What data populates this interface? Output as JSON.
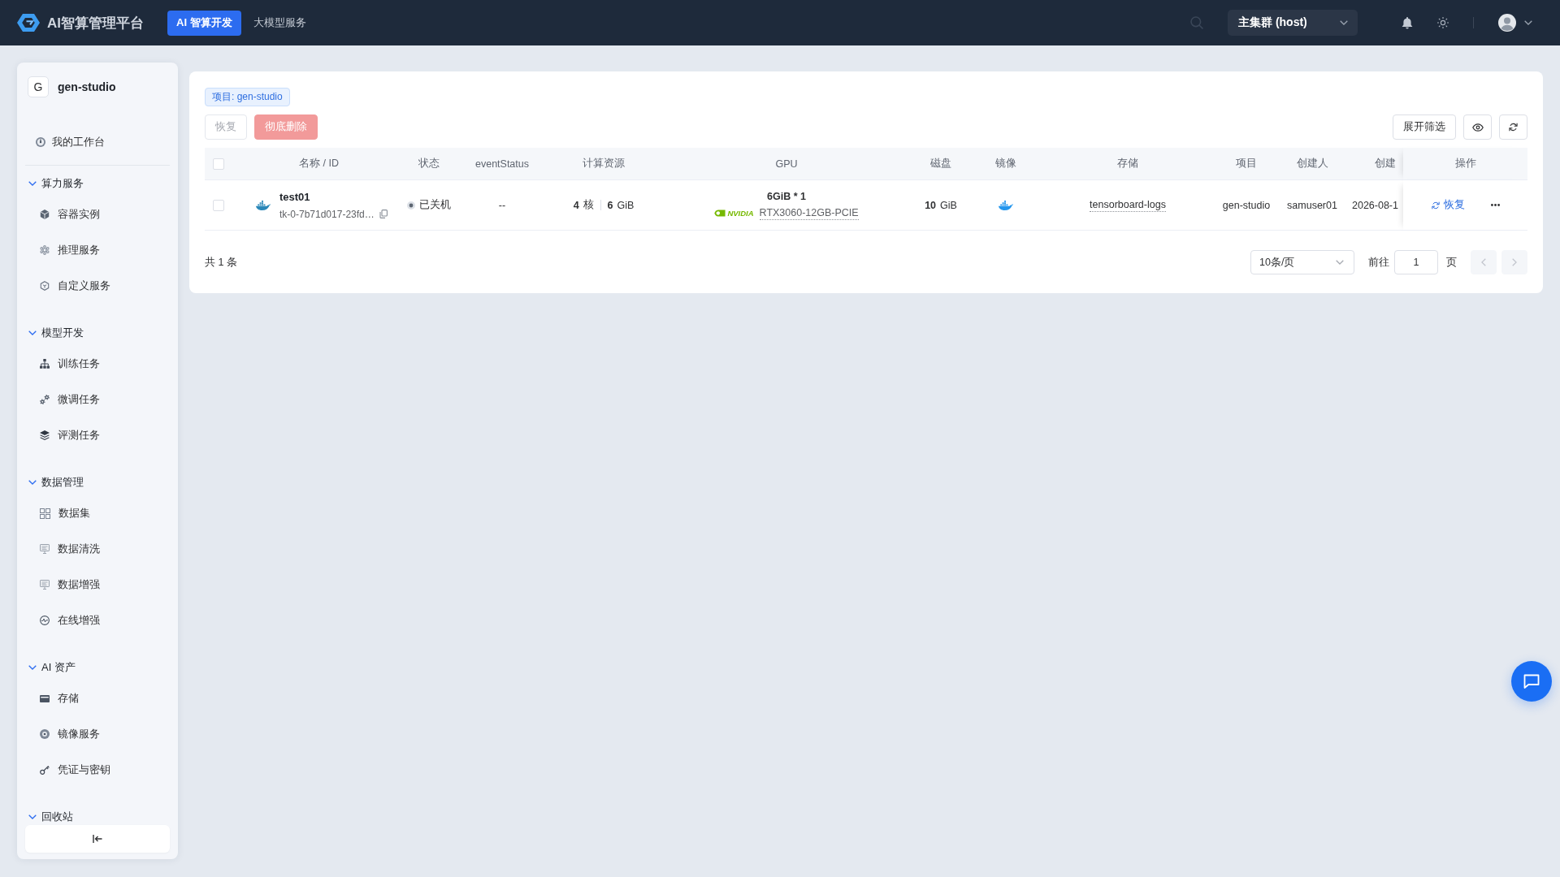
{
  "header": {
    "logo_text": "AI智算管理平台",
    "nav_tabs": [
      {
        "label": "AI 智算开发",
        "selected": true
      },
      {
        "label": "大模型服务",
        "selected": false
      }
    ],
    "cluster_select": {
      "value": "主集群 (host)"
    }
  },
  "sidebar": {
    "workspace": {
      "initial": "G",
      "name": "gen-studio"
    },
    "home_item": {
      "label": "我的工作台",
      "selected": false
    },
    "groups": [
      {
        "title": "算力服务",
        "expanded": true,
        "items": [
          {
            "label": "容器实例",
            "selected": false
          },
          {
            "label": "推理服务",
            "selected": false
          },
          {
            "label": "自定义服务",
            "selected": false
          }
        ]
      },
      {
        "title": "模型开发",
        "expanded": true,
        "items": [
          {
            "label": "训练任务",
            "selected": false
          },
          {
            "label": "微调任务",
            "selected": false
          },
          {
            "label": "评测任务",
            "selected": false
          }
        ]
      },
      {
        "title": "数据管理",
        "expanded": true,
        "items": [
          {
            "label": "数据集",
            "selected": false
          },
          {
            "label": "数据清洗",
            "selected": false
          },
          {
            "label": "数据增强",
            "selected": false
          },
          {
            "label": "在线增强",
            "selected": false
          }
        ]
      },
      {
        "title": "AI 资产",
        "expanded": true,
        "items": [
          {
            "label": "存储",
            "selected": false
          },
          {
            "label": "镜像服务",
            "selected": false
          },
          {
            "label": "凭证与密钥",
            "selected": false
          }
        ]
      },
      {
        "title": "回收站",
        "expanded": true
      }
    ]
  },
  "content": {
    "filter_tag": "项目: gen-studio",
    "actions": [
      {
        "label": "恢复",
        "kind": "default",
        "disabled": true
      },
      {
        "label": "彻底删除",
        "kind": "danger",
        "disabled": true
      }
    ],
    "filter_button": "展开筛选",
    "table": {
      "select_all": {
        "checked": false
      },
      "columns": [
        "名称 / ID",
        "状态",
        "eventStatus",
        "计算资源",
        "GPU",
        "磁盘",
        "镜像",
        "存储",
        "项目",
        "创建人",
        "创建",
        "操作"
      ],
      "rows": [
        {
          "checked": false,
          "name": "test01",
          "id": "tk-0-7b71d017-23fd…",
          "status": {
            "label": "已关机",
            "kind": "stopped"
          },
          "event_status": "--",
          "compute": {
            "cpu": "4",
            "cpu_unit": "核",
            "memory": "6",
            "memory_unit": "GiB"
          },
          "gpu": {
            "spec": "6GiB * 1",
            "vendor": "NVIDIA",
            "model": "RTX3060-12GB-PCIE"
          },
          "disk": {
            "size": "10",
            "unit": "GiB"
          },
          "storage": "tensorboard-logs",
          "project": "gen-studio",
          "creator": "samuser01",
          "created": "2026-08-1",
          "restore_action": "恢复"
        }
      ]
    },
    "pagination": {
      "total": "共 1 条",
      "page_size": "10条/页",
      "goto_label": "前往",
      "page": "1",
      "page_suffix": "页",
      "prev": {
        "disabled": true
      },
      "next": {
        "disabled": true
      }
    }
  }
}
